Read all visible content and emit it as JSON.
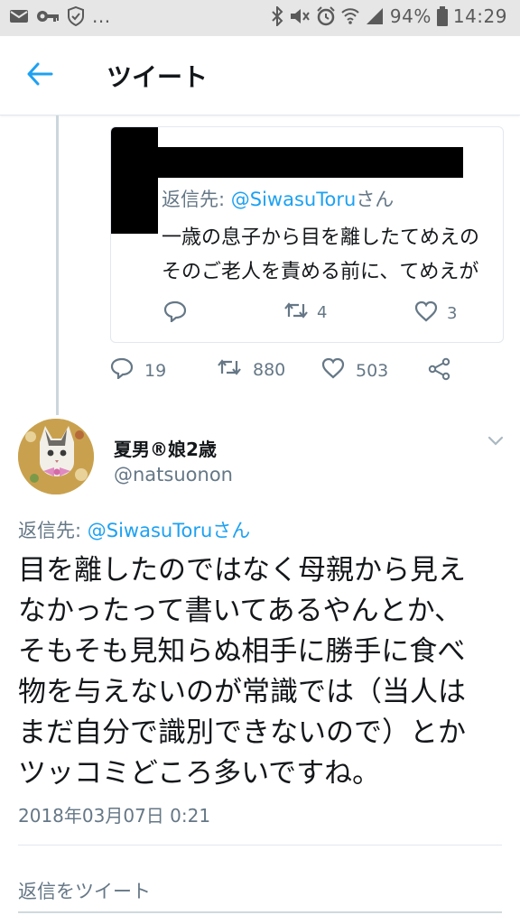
{
  "status_bar": {
    "notif_overflow": "...",
    "battery": "94%",
    "time": "14:29"
  },
  "header": {
    "back_icon": "arrow-left-icon",
    "title": "ツイート"
  },
  "quoted_tweet": {
    "reply_prefix": "返信先: ",
    "reply_handle": "@SiwasuToru",
    "reply_suffix": "さん",
    "line1": "一歳の息子から目を離したてめえの",
    "line2": "そのご老人を責める前に、てめえが",
    "retweet_count": "4",
    "like_count": "3"
  },
  "parent_tweet_actions": {
    "reply_count": "19",
    "retweet_count": "880",
    "like_count": "503"
  },
  "tweet": {
    "author_name": "夏男®娘2歳",
    "author_handle": "@natsuonon",
    "reply_prefix": "返信先: ",
    "reply_handle": "@SiwasuToru",
    "reply_suffix": "さん",
    "text_lines": [
      "目を離したのではなく母親から見え",
      "なかったって書いてあるやんとか、",
      "そもそも見知らぬ相手に勝手に食べ",
      "物を与えないのが常識では（当人は",
      "まだ自分で識別できないので）とか",
      "ツッコミどころ多いですね。"
    ],
    "timestamp": "2018年03月07日 0:21"
  },
  "reply_box": {
    "placeholder": "返信をツイート"
  },
  "colors": {
    "accent": "#1da1f2",
    "secondary_text": "#657786",
    "primary_text": "#14171a",
    "border": "#e1e8ed",
    "status_bar_bg": "#e6e6e6"
  }
}
